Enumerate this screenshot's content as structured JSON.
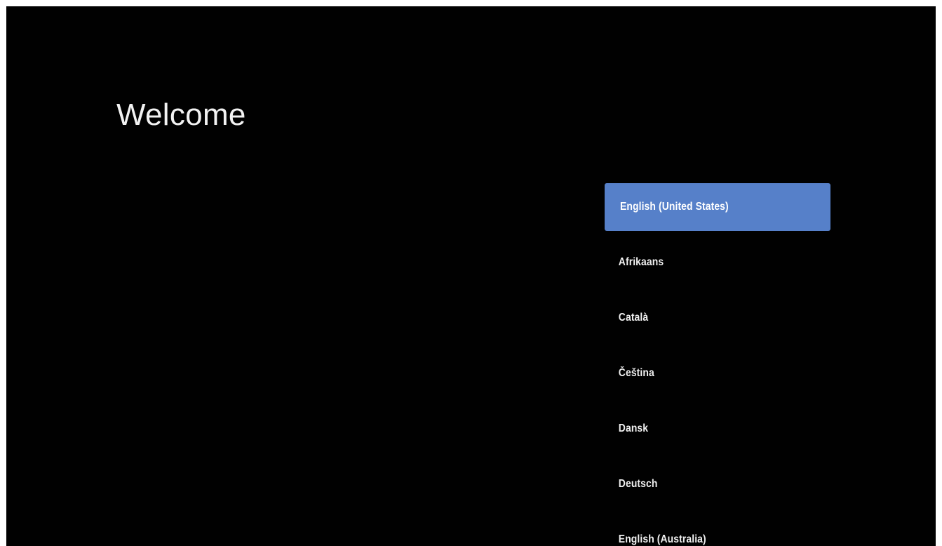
{
  "welcome": {
    "title": "Welcome"
  },
  "language_list": {
    "selected_index": 0,
    "items": [
      {
        "label": "English (United States)"
      },
      {
        "label": "Afrikaans"
      },
      {
        "label": "Català"
      },
      {
        "label": "Čeština"
      },
      {
        "label": "Dansk"
      },
      {
        "label": "Deutsch"
      },
      {
        "label": "English (Australia)"
      }
    ]
  },
  "colors": {
    "background": "#010101",
    "selection": "#5680c9",
    "text": "#f0f0f0"
  }
}
